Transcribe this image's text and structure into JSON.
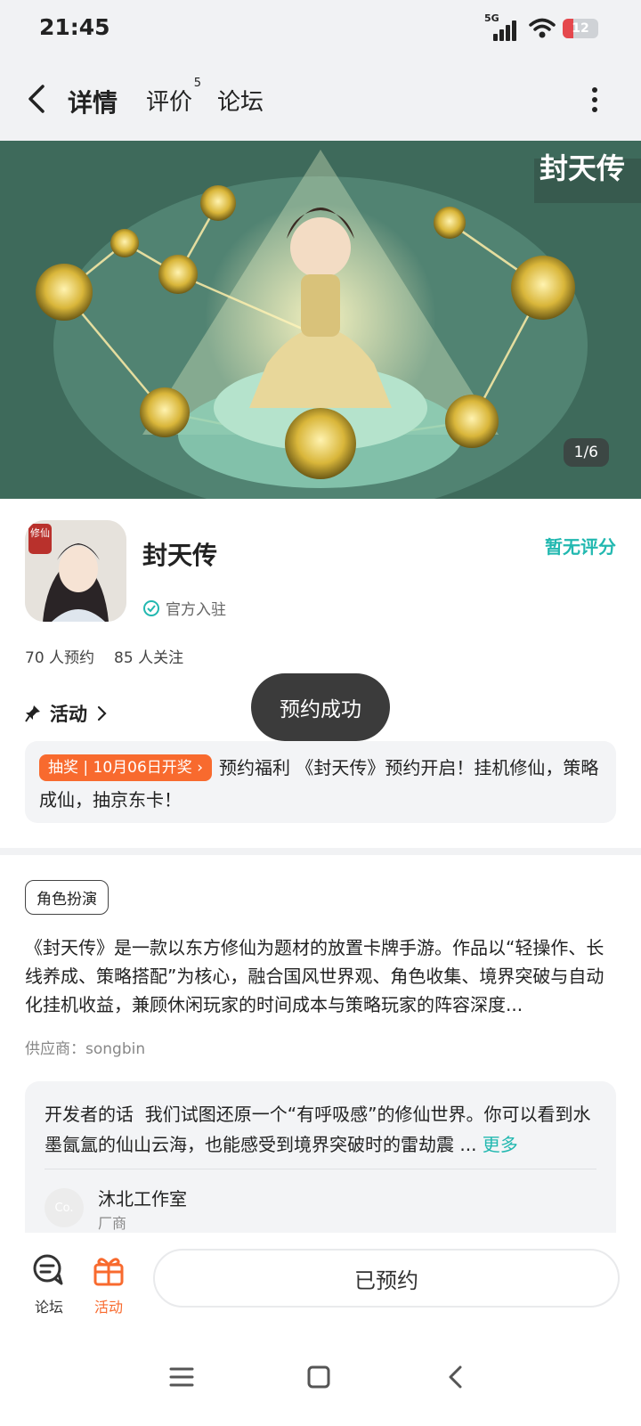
{
  "status_bar": {
    "time": "21:45",
    "network": "5G",
    "battery": "12"
  },
  "header": {
    "tabs": [
      {
        "label": "详情",
        "active": true
      },
      {
        "label": "评价",
        "badge": "5"
      },
      {
        "label": "论坛"
      }
    ],
    "icons": [
      "back-arrow-icon",
      "more-vertical-icon"
    ]
  },
  "banner": {
    "counter": "1/6",
    "logo_text": "封天传"
  },
  "app": {
    "name": "封天传",
    "icon_badge": "修仙",
    "official_label": "官方入驻",
    "rating": "暂无评分",
    "reservations": "70 人预约",
    "followers": "85 人关注"
  },
  "activity": {
    "title": "活动",
    "tag": "抽奖 | 10月06日开奖",
    "text": "预约福利 《封天传》预约开启！挂机修仙，策略成仙，抽京东卡！"
  },
  "toast": "预约成功",
  "genre": "角色扮演",
  "description": "《封天传》是一款以东方修仙为题材的放置卡牌手游。作品以“轻操作、长线养成、策略搭配”为核心，融合国风世界观、角色收集、境界突破与自动化挂机收益，兼顾休闲玩家的时间成本与策略玩家的阵容深度...",
  "supplier": "供应商：songbin",
  "developer": {
    "label": "开发者的话",
    "text": "我们试图还原一个“有呼吸感”的修仙世界。你可以看到水墨氤氲的仙山云海，也能感受到境界突破时的雷劫震 ...",
    "more": "更多",
    "avatar_text": "Co.",
    "name": "沐北工作室",
    "role": "厂商"
  },
  "bottom_bar": {
    "forum": "论坛",
    "activity": "活动",
    "action": "已预约"
  },
  "colors": {
    "accent": "#22c6c0",
    "orange": "#f86a2e",
    "toast_bg": "#3b3b3b"
  }
}
